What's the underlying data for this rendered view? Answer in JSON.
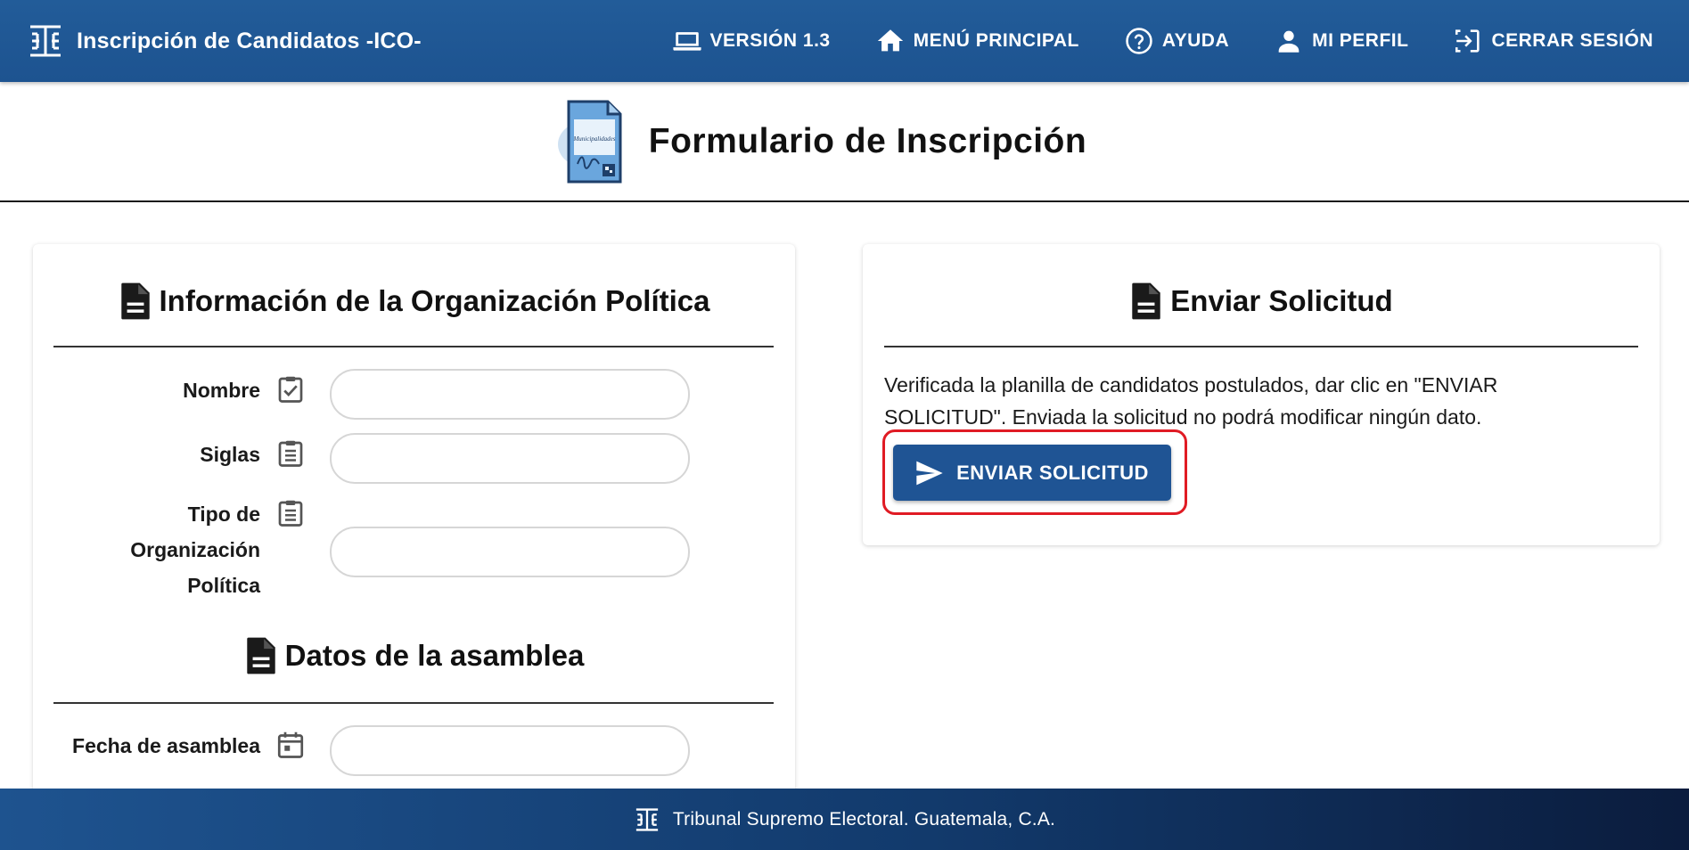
{
  "header": {
    "app_title": "Inscripción de Candidatos -ICO-",
    "nav": [
      {
        "label": "VERSIÓN 1.3",
        "icon": "laptop-icon"
      },
      {
        "label": "MENÚ PRINCIPAL",
        "icon": "home-icon"
      },
      {
        "label": "AYUDA",
        "icon": "help-circle-icon"
      },
      {
        "label": "MI PERFIL",
        "icon": "person-icon"
      },
      {
        "label": "CERRAR SESIÓN",
        "icon": "logout-icon"
      }
    ]
  },
  "page": {
    "title": "Formulario de Inscripción",
    "image_icon": "municipalidades-document-icon",
    "image_text": "Municipalidades"
  },
  "left_card": {
    "org_heading": "Información de la Organización Política",
    "fields": [
      {
        "label": "Nombre",
        "icon": "checked-clipboard-icon",
        "value": ""
      },
      {
        "label": "Siglas",
        "icon": "clipboard-icon",
        "value": ""
      },
      {
        "label_lines": [
          "Tipo de",
          "Organización",
          "Política"
        ],
        "icon": "clipboard-icon",
        "value": ""
      }
    ],
    "assembly_heading": "Datos de la asamblea",
    "assembly_fields": [
      {
        "label": "Fecha de asamblea",
        "icon": "calendar-icon",
        "value": ""
      }
    ]
  },
  "right_card": {
    "heading": "Enviar Solicitud",
    "instructions": "Verificada la planilla de candidatos postulados, dar clic en \"ENVIAR SOLICITUD\". Enviada la solicitud no podrá modificar ningún dato.",
    "send_button": "ENVIAR SOLICITUD"
  },
  "footer": {
    "text": "Tribunal Supremo Electoral. Guatemala, C.A."
  },
  "colors": {
    "header_bg": "#225c99",
    "button_bg": "#1f5494",
    "highlight": "#e01b24"
  }
}
